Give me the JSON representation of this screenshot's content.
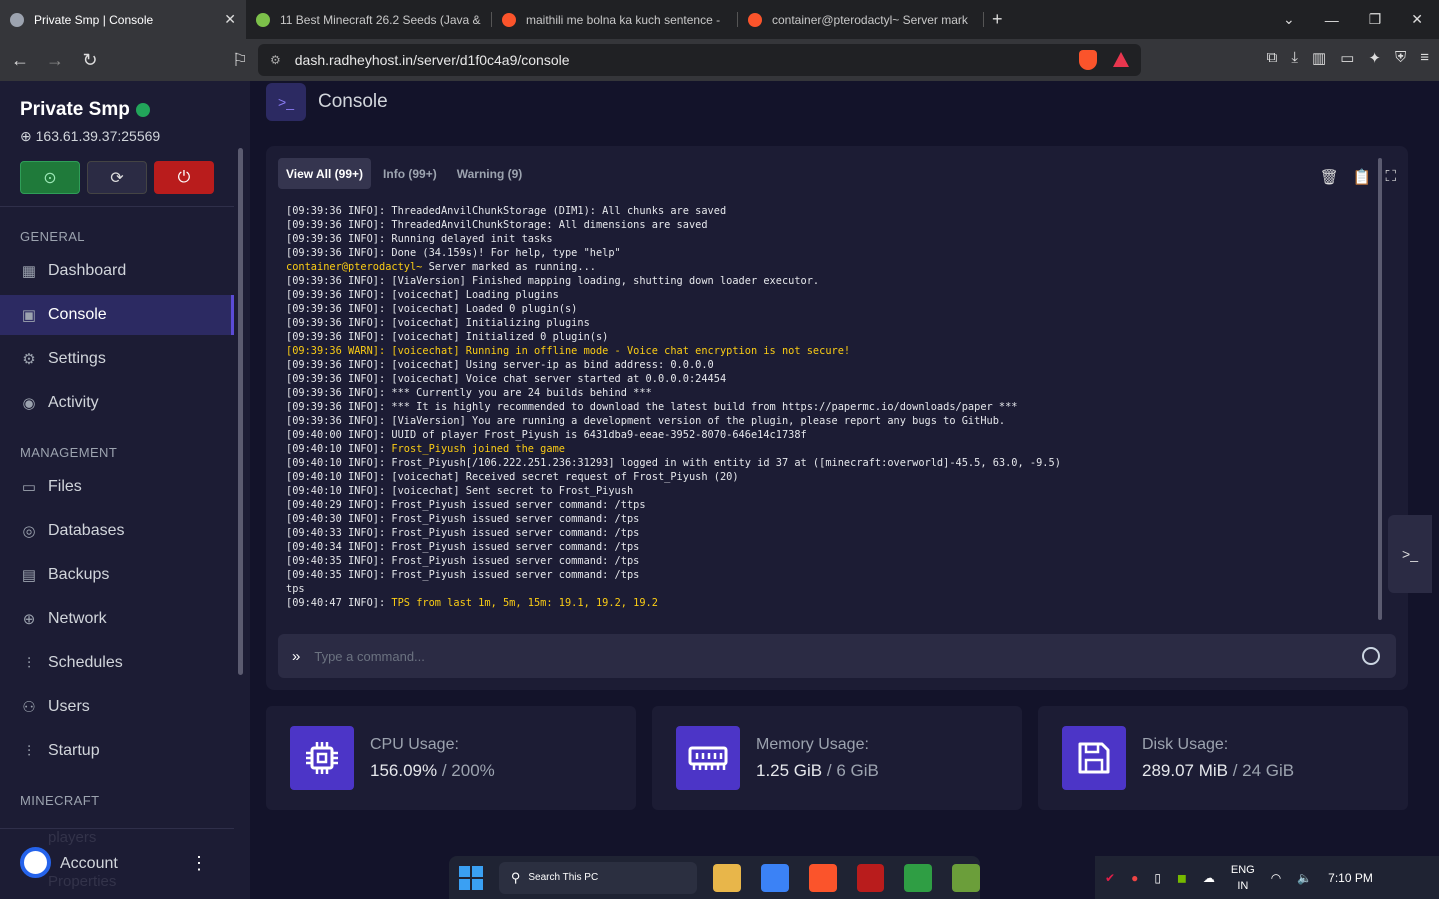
{
  "browser": {
    "tabs": [
      {
        "title": "Private Smp | Console",
        "color": "#9ca3af"
      },
      {
        "title": "11 Best Minecraft 26.2 Seeds (Java &",
        "color": "#7cc04a"
      },
      {
        "title": "maithili me bolna ka kuch sentence -",
        "color": "#fb542b"
      },
      {
        "title": "container@pterodactyl~ Server mark",
        "color": "#fb542b"
      }
    ],
    "close": "✕",
    "new_tab": "+",
    "url": "dash.radheyhost.in/server/d1f0c4a9/console"
  },
  "server": {
    "name": "Private Smp",
    "ip": "163.61.39.37:25569",
    "status_color": "#22a55a"
  },
  "power": {
    "start_color": "#1f7a3a",
    "restart_color": "#2b2b44",
    "stop_color": "#b91c1c"
  },
  "sidebar": {
    "general_heading": "GENERAL",
    "general_items": [
      "Dashboard",
      "Console",
      "Settings",
      "Activity"
    ],
    "management_heading": "MANAGEMENT",
    "management_items": [
      "Files",
      "Databases",
      "Backups",
      "Network",
      "Schedules",
      "Users",
      "Startup"
    ],
    "minecraft_heading": "MINECRAFT",
    "minecraft_items": [
      "players",
      "Properties"
    ],
    "account_label": "Account"
  },
  "page": {
    "title": "Console"
  },
  "console": {
    "filter_tabs": [
      "View All (99+)",
      "Info (99+)",
      "Warning (9)"
    ],
    "command_placeholder": "Type a command...",
    "lines": [
      {
        "t": "[09:39:36 INFO]: ThreadedAnvilChunkStorage (DIM1): All chunks are saved"
      },
      {
        "t": "[09:39:36 INFO]: ThreadedAnvilChunkStorage: All dimensions are saved"
      },
      {
        "t": "[09:39:36 INFO]: Running delayed init tasks"
      },
      {
        "t": "[09:39:36 INFO]: Done (34.159s)! For help, type \"help\""
      },
      {
        "t": "container@pterodactyl~ Server marked as running...",
        "kind": "prompt",
        "prefix": "container@pterodactyl~",
        "rest": " Server marked as running..."
      },
      {
        "t": "[09:39:36 INFO]: [ViaVersion] Finished mapping loading, shutting down loader executor."
      },
      {
        "t": "[09:39:36 INFO]: [voicechat] Loading plugins"
      },
      {
        "t": "[09:39:36 INFO]: [voicechat] Loaded 0 plugin(s)"
      },
      {
        "t": "[09:39:36 INFO]: [voicechat] Initializing plugins"
      },
      {
        "t": "[09:39:36 INFO]: [voicechat] Initialized 0 plugin(s)"
      },
      {
        "t": "[09:39:36 WARN]: [voicechat] Running in offline mode - Voice chat encryption is not secure!",
        "kind": "warn"
      },
      {
        "t": "[09:39:36 INFO]: [voicechat] Using server-ip as bind address: 0.0.0.0"
      },
      {
        "t": "[09:39:36 INFO]: [voicechat] Voice chat server started at 0.0.0.0:24454"
      },
      {
        "t": "[09:39:36 INFO]: *** Currently you are 24 builds behind ***"
      },
      {
        "t": "[09:39:36 INFO]: *** It is highly recommended to download the latest build from https://papermc.io/downloads/paper ***"
      },
      {
        "t": "[09:39:36 INFO]: [ViaVersion] You are running a development version of the plugin, please report any bugs to GitHub."
      },
      {
        "t": "[09:40:00 INFO]: UUID of player Frost_Piyush is 6431dba9-eeae-3952-8070-646e14c1738f"
      },
      {
        "t": "[09:40:10 INFO]: Frost_Piyush joined the game",
        "kind": "yellow",
        "prefix": "[09:40:10 INFO]: ",
        "rest": "Frost_Piyush joined the game"
      },
      {
        "t": "[09:40:10 INFO]: Frost_Piyush[/106.222.251.236:31293] logged in with entity id 37 at ([minecraft:overworld]-45.5, 63.0, -9.5)"
      },
      {
        "t": "[09:40:10 INFO]: [voicechat] Received secret request of Frost_Piyush (20)"
      },
      {
        "t": "[09:40:10 INFO]: [voicechat] Sent secret to Frost_Piyush"
      },
      {
        "t": "[09:40:29 INFO]: Frost_Piyush issued server command: /ttps"
      },
      {
        "t": "[09:40:30 INFO]: Frost_Piyush issued server command: /tps"
      },
      {
        "t": "[09:40:33 INFO]: Frost_Piyush issued server command: /tps"
      },
      {
        "t": "[09:40:34 INFO]: Frost_Piyush issued server command: /tps"
      },
      {
        "t": "[09:40:35 INFO]: Frost_Piyush issued server command: /tps"
      },
      {
        "t": "[09:40:35 INFO]: Frost_Piyush issued server command: /tps"
      },
      {
        "t": "tps"
      },
      {
        "t": "[09:40:47 INFO]: TPS from last 1m, 5m, 15m: 19.1, 19.2, 19.2",
        "kind": "yellow",
        "prefix": "[09:40:47 INFO]: ",
        "rest": "TPS from last 1m, 5m, 15m: 19.1, 19.2, 19.2"
      }
    ]
  },
  "stats": {
    "cpu": {
      "label": "CPU Usage:",
      "value": "156.09%",
      "limit": " / 200%"
    },
    "memory": {
      "label": "Memory Usage:",
      "value": "1.25 GiB",
      "limit": " / 6 GiB"
    },
    "disk": {
      "label": "Disk Usage:",
      "value": "289.07 MiB",
      "limit": " / 24 GiB"
    }
  },
  "taskbar": {
    "search_label": "Search This PC",
    "lang_top": "ENG",
    "lang_bottom": "IN",
    "time": "7:10 PM"
  }
}
